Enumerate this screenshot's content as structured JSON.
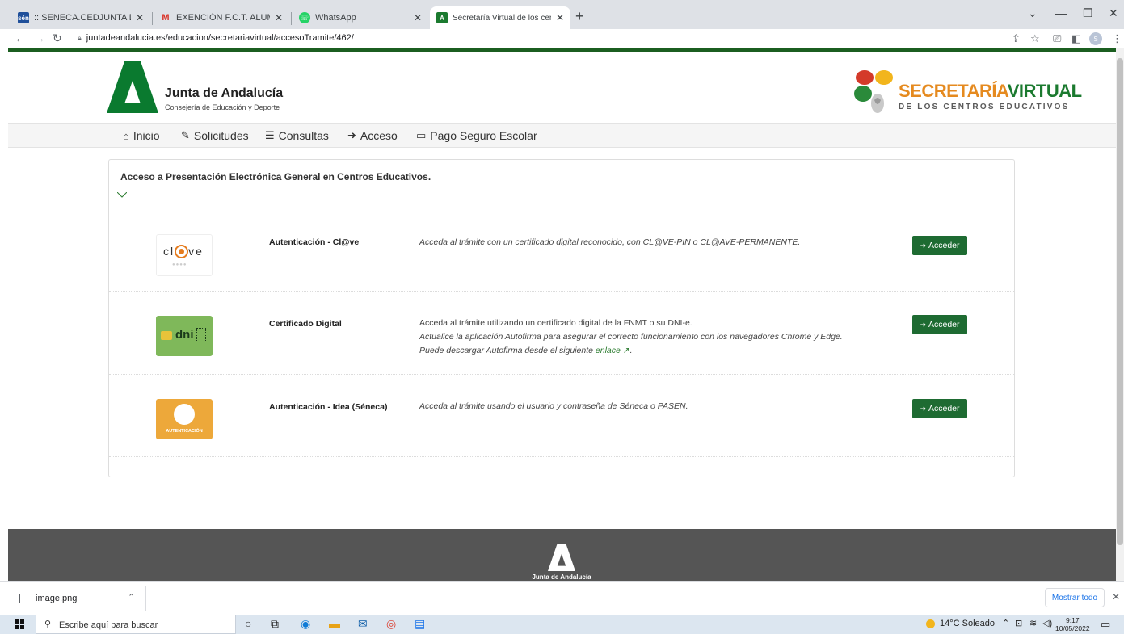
{
  "browser": {
    "tabs": [
      {
        "title": ":: SENECA.CEDJUNTA DE ANDALU",
        "favicon": "seneca"
      },
      {
        "title": "EXENCIÓN F.C.T. ALUMNADO CI",
        "favicon": "gmail"
      },
      {
        "title": "WhatsApp",
        "favicon": "whatsapp"
      },
      {
        "title": "Secretaría Virtual de los centros e",
        "favicon": "junta"
      }
    ],
    "url": "juntadeandalucia.es/educacion/secretariavirtual/accesoTramite/462/"
  },
  "header": {
    "org_name": "Junta de Andalucía",
    "org_sub": "Consejería de Educación y Deporte",
    "sv_title_a": "SECRETARÍA",
    "sv_title_b": "VIRTUAL",
    "sv_sub": "DE LOS CENTROS EDUCATIVOS"
  },
  "nav": {
    "items": [
      {
        "label": "Inicio",
        "icon": "home-icon"
      },
      {
        "label": "Solicitudes",
        "icon": "pencil-icon"
      },
      {
        "label": "Consultas",
        "icon": "list-icon"
      },
      {
        "label": "Acceso",
        "icon": "sign-in-icon"
      },
      {
        "label": "Pago Seguro Escolar",
        "icon": "credit-card-icon"
      }
    ]
  },
  "panel": {
    "title": "Acceso a Presentación Electrónica General en Centros Educativos.",
    "rows": [
      {
        "name": "Autenticación - Cl@ve",
        "desc": "Acceda al trámite con un certificado digital reconocido, con CL@VE-PIN o CL@AVE-PERMANENTE.",
        "button": "Acceder"
      },
      {
        "name": "Certificado Digital",
        "desc": "Acceda al trámite utilizando un certificado digital de la FNMT o su DNI-e.",
        "desc2": "Actualice la aplicación Autofirma para asegurar el correcto funcionamiento con los navegadores Chrome y Edge.",
        "desc3": "Puede descargar Autofirma desde el siguiente ",
        "link": "enlace",
        "button": "Acceder"
      },
      {
        "name": "Autenticación - Idea (Séneca)",
        "desc": "Acceda al trámite usando el usuario y contraseña de Séneca o PASEN.",
        "button": "Acceder"
      }
    ],
    "logos": {
      "clave": "cl",
      "clave_end": "ve",
      "dni": "dni",
      "auth": "AUTENTICACIÓN"
    }
  },
  "footer": {
    "org_name": "Junta de Andalucía"
  },
  "downloads": {
    "file": "image.png",
    "show_all": "Mostrar todo"
  },
  "taskbar": {
    "search_placeholder": "Escribe aquí para buscar",
    "weather": "14°C  Soleado",
    "time": "9:17",
    "date": "10/05/2022"
  },
  "colors": {
    "brand_green": "#1e6b32",
    "accent_orange": "#e58a1f"
  }
}
